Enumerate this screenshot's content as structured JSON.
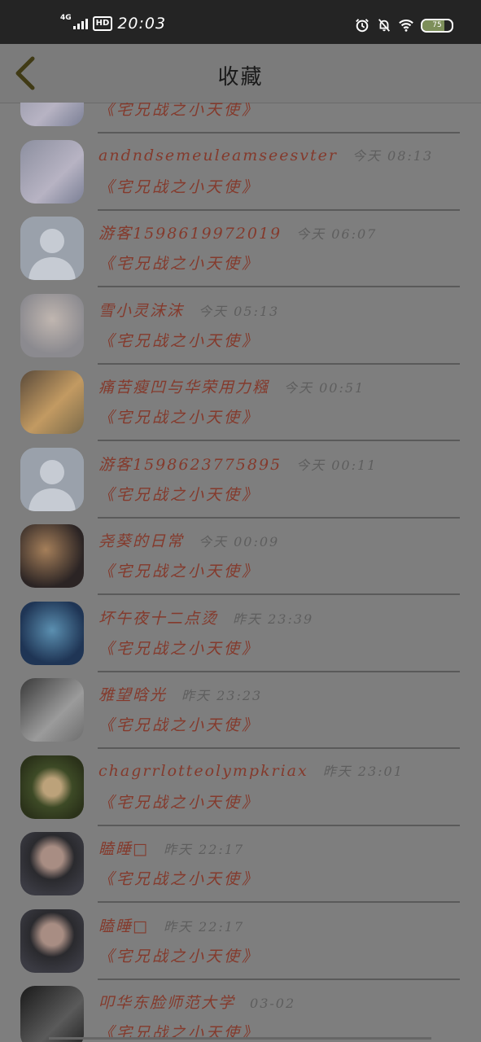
{
  "status_bar": {
    "network": "4G",
    "hd_badge": "HD",
    "time": "20:03",
    "battery_level": "75",
    "battery_fraction": 0.75,
    "icons": [
      "alarm-icon",
      "mute-bell-icon",
      "wifi-icon",
      "battery-icon"
    ]
  },
  "header": {
    "title": "收藏",
    "back_icon": "chevron-left-icon",
    "back_color": "#403a15"
  },
  "colors": {
    "name": "#843a2c",
    "time": "#5e5e5e",
    "overlay_bg": "#7e7e7e"
  },
  "items": [
    {
      "name": "",
      "time": "",
      "subtitle": "《宅兄战之小天使》",
      "avatar": "anime-purple"
    },
    {
      "name": "andndsemeuleamseesvter",
      "time": "今天 08:13",
      "subtitle": "《宅兄战之小天使》",
      "avatar": "anime-silver"
    },
    {
      "name": "游客1598619972019",
      "time": "今天 06:07",
      "subtitle": "《宅兄战之小天使》",
      "avatar": "default-user"
    },
    {
      "name": "雪小灵沫沫",
      "time": "今天 05:13",
      "subtitle": "《宅兄战之小天使》",
      "avatar": "anime-white-hair"
    },
    {
      "name": "痛苦瘦凹与华荣用力糨",
      "time": "今天 00:51",
      "subtitle": "《宅兄战之小天使》",
      "avatar": "photo-girl-headphones"
    },
    {
      "name": "游客1598623775895",
      "time": "今天 00:11",
      "subtitle": "《宅兄战之小天使》",
      "avatar": "default-user"
    },
    {
      "name": "尧葵的日常",
      "time": "今天 00:09",
      "subtitle": "《宅兄战之小天使》",
      "avatar": "photo-dark-cat"
    },
    {
      "name": "坏午夜十二点烫",
      "time": "昨天 23:39",
      "subtitle": "《宅兄战之小天使》",
      "avatar": "anime-blue-hair"
    },
    {
      "name": "雅望晗光",
      "time": "昨天 23:23",
      "subtitle": "《宅兄战之小天使》",
      "avatar": "photo-cat"
    },
    {
      "name": "chagrrlotteolympkriax",
      "time": "昨天 23:01",
      "subtitle": "《宅兄战之小天使》",
      "avatar": "photo-flowers"
    },
    {
      "name": "瞌睡□",
      "time": "昨天 22:17",
      "subtitle": "《宅兄战之小天使》",
      "avatar": "anime-girl-dark-hair"
    },
    {
      "name": "瞌睡□",
      "time": "昨天 22:17",
      "subtitle": "《宅兄战之小天使》",
      "avatar": "anime-girl-dark-hair"
    },
    {
      "name": "叩华东脸师范大学",
      "time": "03-02",
      "subtitle": "《宅兄战之小天使》",
      "avatar": "photo-bw"
    }
  ]
}
